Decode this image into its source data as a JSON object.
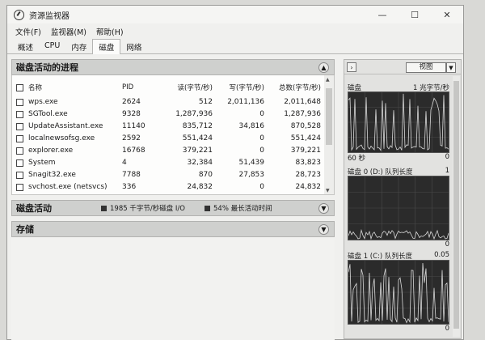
{
  "window": {
    "title": "资源监视器",
    "controls": [
      "—",
      "☐",
      "✕"
    ]
  },
  "menu": [
    "文件(F)",
    "监视器(M)",
    "帮助(H)"
  ],
  "tabs": [
    {
      "label": "概述",
      "active": false
    },
    {
      "label": "CPU",
      "active": false
    },
    {
      "label": "内存",
      "active": false
    },
    {
      "label": "磁盘",
      "active": true
    },
    {
      "label": "网络",
      "active": false
    }
  ],
  "processes": {
    "title": "磁盘活动的进程",
    "columns": {
      "name": "名称",
      "pid": "PID",
      "read": "读(字节/秒)",
      "write": "写(字节/秒)",
      "total": "总数(字节/秒)"
    },
    "rows": [
      {
        "name": "wps.exe",
        "pid": "2624",
        "read": "512",
        "write": "2,011,136",
        "total": "2,011,648"
      },
      {
        "name": "SGTool.exe",
        "pid": "9328",
        "read": "1,287,936",
        "write": "0",
        "total": "1,287,936"
      },
      {
        "name": "UpdateAssistant.exe",
        "pid": "11140",
        "read": "835,712",
        "write": "34,816",
        "total": "870,528"
      },
      {
        "name": "localnewsofsg.exe",
        "pid": "2592",
        "read": "551,424",
        "write": "0",
        "total": "551,424"
      },
      {
        "name": "explorer.exe",
        "pid": "16768",
        "read": "379,221",
        "write": "0",
        "total": "379,221"
      },
      {
        "name": "System",
        "pid": "4",
        "read": "32,384",
        "write": "51,439",
        "total": "83,823"
      },
      {
        "name": "Snagit32.exe",
        "pid": "7788",
        "read": "870",
        "write": "27,853",
        "total": "28,723"
      },
      {
        "name": "svchost.exe (netsvcs)",
        "pid": "336",
        "read": "24,832",
        "write": "0",
        "total": "24,832"
      }
    ]
  },
  "activity": {
    "title": "磁盘活动",
    "stat1": "1985 千字节/秒磁盘 I/O",
    "stat2": "54% 最长活动时间"
  },
  "storage": {
    "title": "存储"
  },
  "right": {
    "view_label": "视图",
    "colors": {
      "graph_bg": "#2b2b2b",
      "graph_line": "#d8d8d8"
    },
    "graphs": [
      {
        "title": "磁盘",
        "max": "1 兆字节/秒",
        "time": "60 秒",
        "min": "0"
      },
      {
        "title": "磁盘 0 (D:) 队列长度",
        "max": "1",
        "min": "0"
      },
      {
        "title": "磁盘 1 (C:) 队列长度",
        "max": "0.05",
        "min": "0"
      }
    ]
  }
}
